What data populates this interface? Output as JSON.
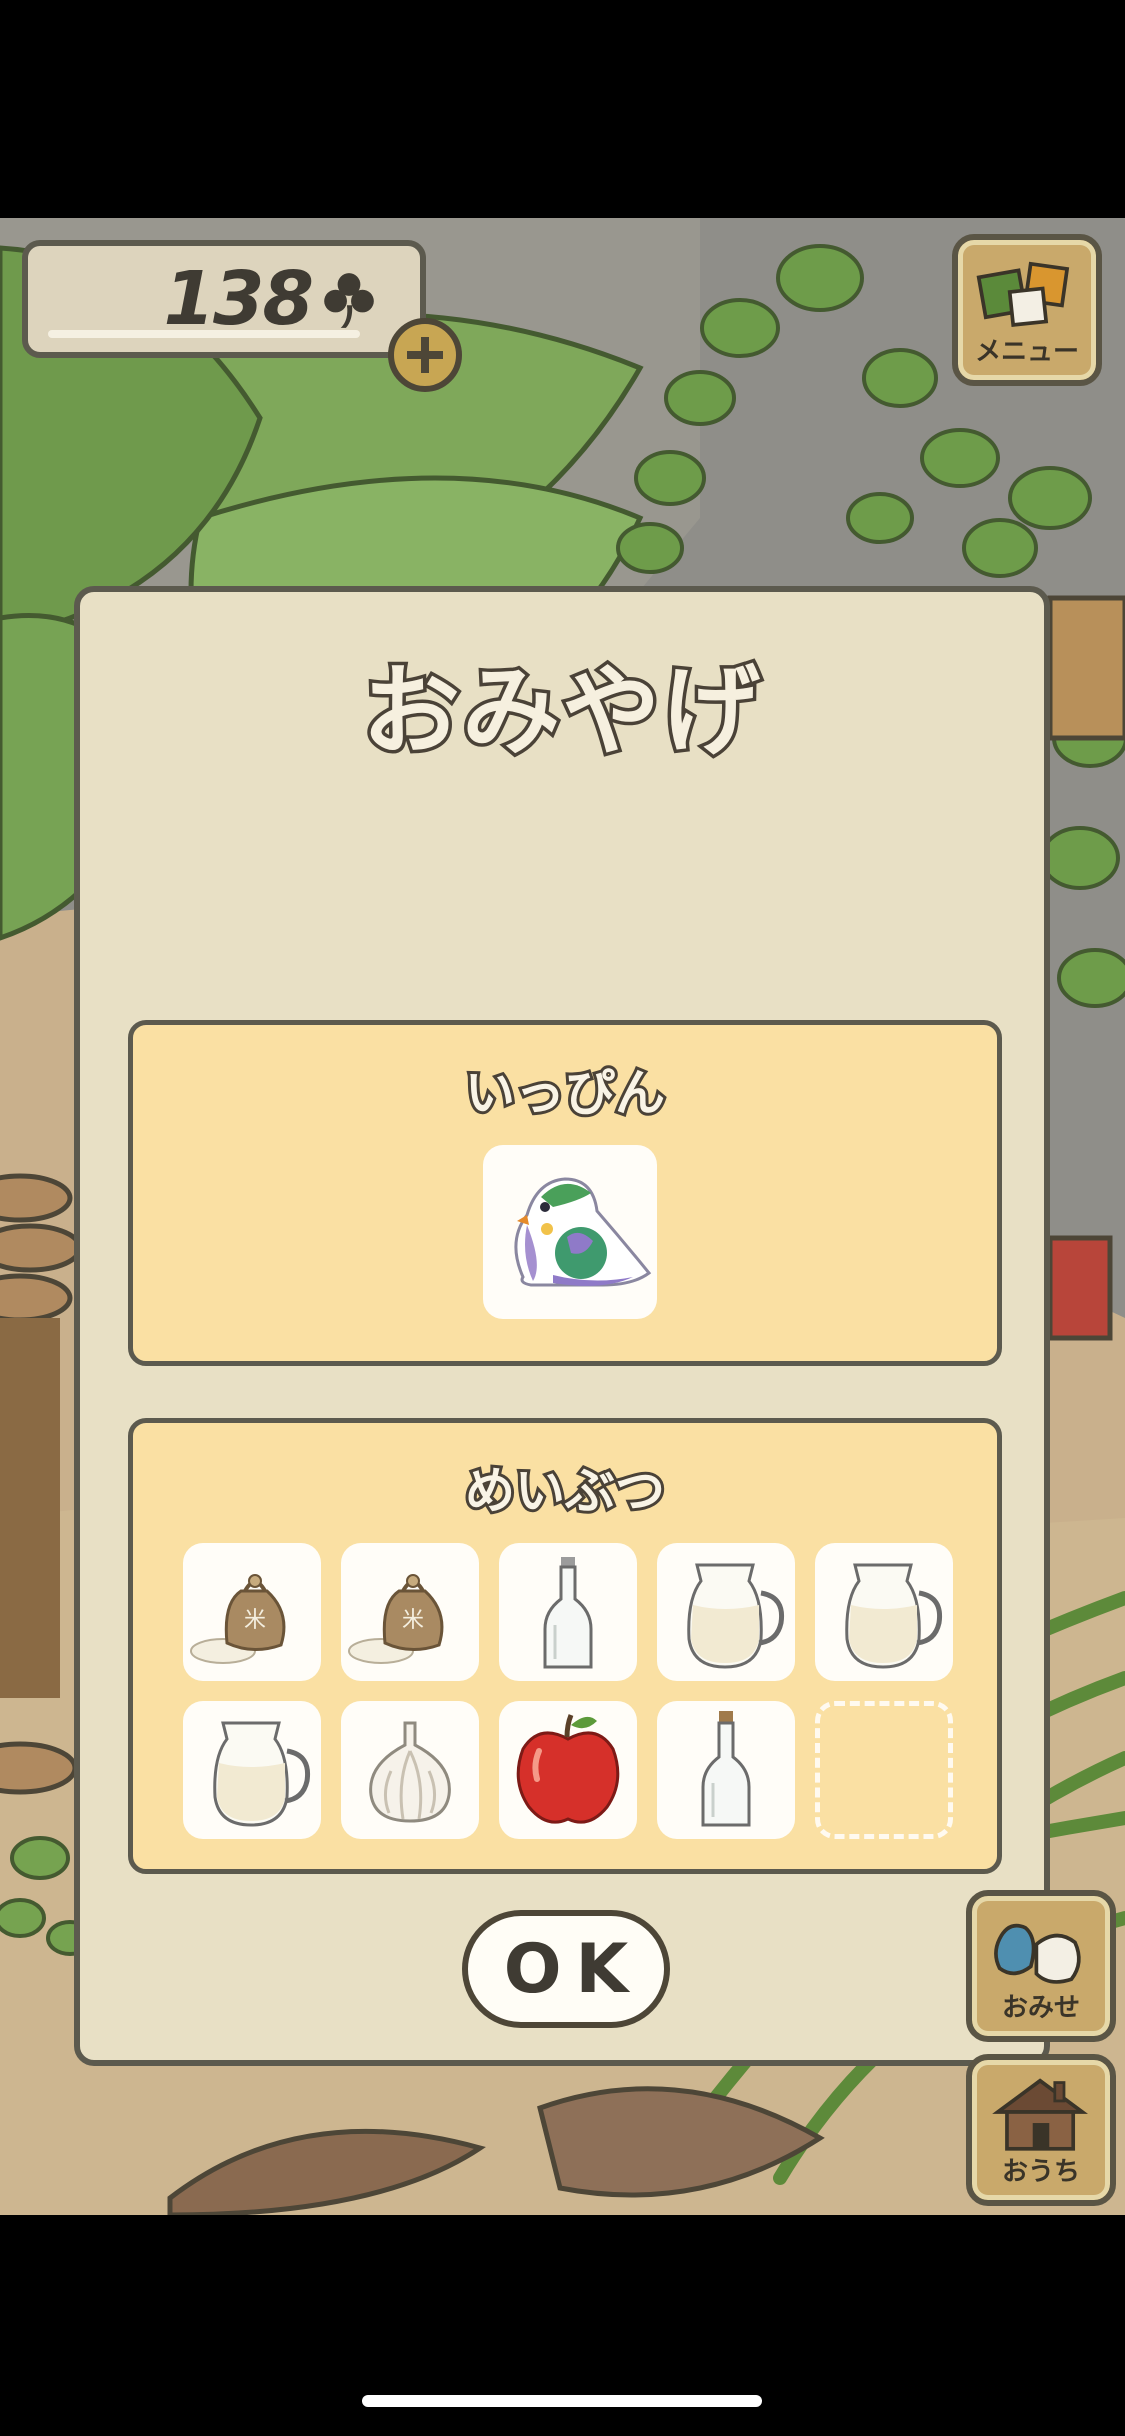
{
  "hud": {
    "clover_count": "138"
  },
  "menu": {
    "label": "メニュー"
  },
  "shop": {
    "label": "おみせ"
  },
  "home": {
    "label": "おうち"
  },
  "dialog": {
    "title": "おみやげ",
    "rare_section": {
      "title": "いっぴん",
      "item_icon": "pigeon-figurine-icon"
    },
    "local_section": {
      "title": "めいぶつ",
      "items": [
        {
          "icon": "rice-sack-icon"
        },
        {
          "icon": "rice-sack-icon"
        },
        {
          "icon": "glass-bottle-icon"
        },
        {
          "icon": "milk-jug-icon"
        },
        {
          "icon": "milk-jug-icon"
        },
        {
          "icon": "milk-jug-icon"
        },
        {
          "icon": "garlic-icon"
        },
        {
          "icon": "apple-icon"
        },
        {
          "icon": "glass-bottle-icon"
        },
        {
          "icon": "empty-slot"
        }
      ]
    },
    "ok_label": "OK"
  },
  "colors": {
    "dialog_bg": "#e8e0c5",
    "section_bg": "#fae0a3",
    "outline": "#5c5a4e"
  }
}
